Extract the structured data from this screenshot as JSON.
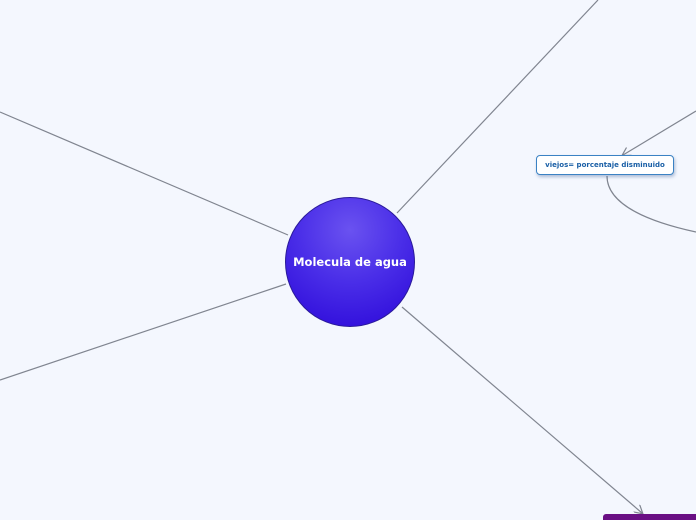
{
  "center": {
    "label": "Molecula de agua"
  },
  "topics": [
    {
      "label": "viejos= porcentaje  disminuido"
    }
  ],
  "colors": {
    "background": "#f4f7fe",
    "connector": "#808590",
    "center_fill": "#4a2ee8",
    "topic_border": "#3b82c4",
    "topic_text": "#1a5fa6",
    "purple_node": "#6a0f84"
  }
}
